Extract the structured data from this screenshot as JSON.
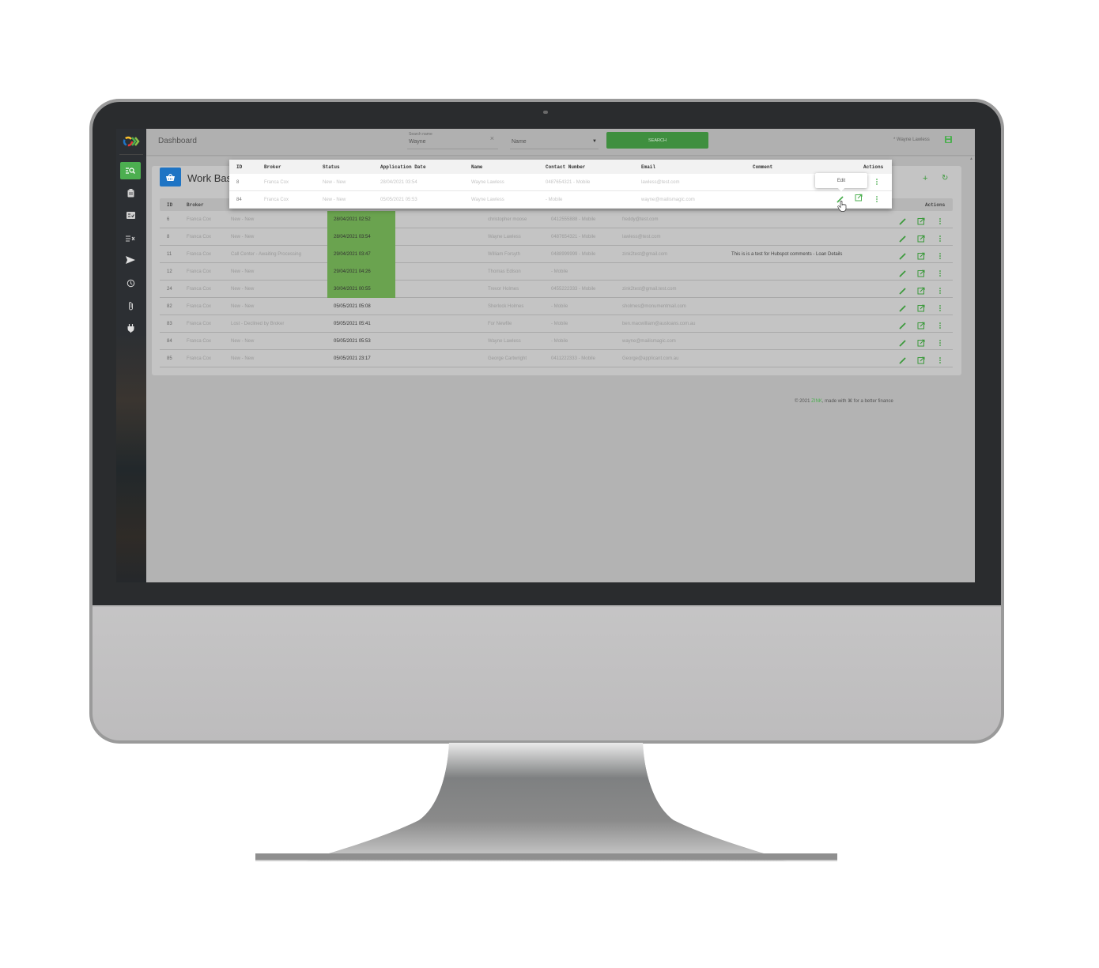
{
  "app": {
    "page_title": "Dashboard",
    "user_name": "* Wayne Lawless",
    "accent_color": "#4caf50",
    "brand_blue": "#1e74c4",
    "date_highlight_color": "#6aa34f"
  },
  "sidebar": {
    "items": [
      {
        "icon": "search-list-icon",
        "active": true
      },
      {
        "icon": "clipboard-icon",
        "active": false
      },
      {
        "icon": "checklist-card-icon",
        "active": false
      },
      {
        "icon": "list-clear-icon",
        "active": false
      },
      {
        "icon": "send-icon",
        "active": false
      },
      {
        "icon": "history-icon",
        "active": false
      },
      {
        "icon": "paperclip-icon",
        "active": false
      },
      {
        "icon": "plug-icon",
        "active": false
      }
    ]
  },
  "search": {
    "label": "Search name",
    "value": "Wayne",
    "clear_icon": "×",
    "field_select": "Name",
    "button_label": "SEARCH"
  },
  "card": {
    "title": "Work Basket",
    "add_icon": "+",
    "refresh_icon": "↻"
  },
  "table": {
    "columns": [
      "ID",
      "Broker",
      "Status",
      "Application Date",
      "Name",
      "Contact Number",
      "Email",
      "Comment",
      "Actions"
    ],
    "rows": [
      {
        "id": "6",
        "broker": "Franca Cox",
        "status": "New - New",
        "date": "28/04/2021 02:52",
        "highlight": true,
        "name": "christopher moose",
        "contact": "0412555888 - Mobile",
        "email": "freddy@test.com",
        "comment": ""
      },
      {
        "id": "8",
        "broker": "Franca Cox",
        "status": "New - New",
        "date": "28/04/2021 03:54",
        "highlight": true,
        "name": "Wayne Lawless",
        "contact": "0487654321 - Mobile",
        "email": "lawless@test.com",
        "comment": ""
      },
      {
        "id": "11",
        "broker": "Franca Cox",
        "status": "Call Center - Awaiting Processing",
        "date": "29/04/2021 03:47",
        "highlight": true,
        "name": "William Forsyth",
        "contact": "0488999999 - Mobile",
        "email": "zink2test@gmail.com",
        "comment": "This is is a test for Hubspot comments - Loan Details"
      },
      {
        "id": "12",
        "broker": "Franca Cox",
        "status": "New - New",
        "date": "29/04/2021 04:26",
        "highlight": true,
        "name": "Thomas Edison",
        "contact": "- Mobile",
        "email": "",
        "comment": ""
      },
      {
        "id": "24",
        "broker": "Franca Cox",
        "status": "New - New",
        "date": "30/04/2021 00:55",
        "highlight": true,
        "name": "Trevor Holmes",
        "contact": "0455222333 - Mobile",
        "email": "zink2test@gmail.test.com",
        "comment": ""
      },
      {
        "id": "82",
        "broker": "Franca Cox",
        "status": "New - New",
        "date": "05/05/2021 05:08",
        "highlight": false,
        "name": "Sherlock Holmes",
        "contact": "- Mobile",
        "email": "sholmes@monumentmail.com",
        "comment": ""
      },
      {
        "id": "83",
        "broker": "Franca Cox",
        "status": "Lost - Declined by Broker",
        "date": "05/05/2021 05:41",
        "highlight": false,
        "name": "For Newfile",
        "contact": "- Mobile",
        "email": "ben.macwilliam@ausloans.com.au",
        "comment": ""
      },
      {
        "id": "84",
        "broker": "Franca Cox",
        "status": "New - New",
        "date": "05/05/2021 05:53",
        "highlight": false,
        "name": "Wayne Lawless",
        "contact": "- Mobile",
        "email": "wayne@mailismagic.com",
        "comment": ""
      },
      {
        "id": "85",
        "broker": "Franca Cox",
        "status": "New - New",
        "date": "05/05/2021 23:17",
        "highlight": false,
        "name": "George Cartwright",
        "contact": "0411222333 - Mobile",
        "email": "George@applicant.com.au",
        "comment": ""
      }
    ]
  },
  "popup": {
    "columns": [
      "ID",
      "Broker",
      "Status",
      "Application Date",
      "Name",
      "Contact Number",
      "Email",
      "Comment",
      "Actions"
    ],
    "rows": [
      {
        "id": "8",
        "broker": "Franca Cox",
        "status": "New - New",
        "date": "28/04/2021 03:54",
        "name": "Wayne Lawless",
        "contact": "0487654321 - Mobile",
        "email": "lawless@test.com",
        "comment": ""
      },
      {
        "id": "84",
        "broker": "Franca Cox",
        "status": "New - New",
        "date": "05/05/2021 05:53",
        "name": "Wayne Lawless",
        "contact": "- Mobile",
        "email": "wayne@mailismagic.com",
        "comment": ""
      }
    ],
    "tooltip": "Edit"
  },
  "footer": {
    "prefix": "© 2021 ",
    "brand": "ZINK",
    "suffix": ", made with ⌘ for a better finance"
  }
}
